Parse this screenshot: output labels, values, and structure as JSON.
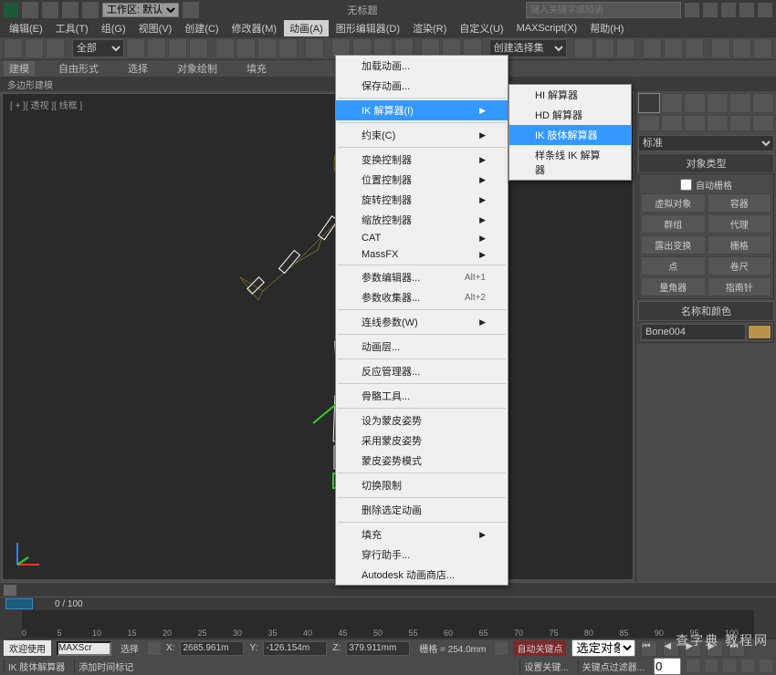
{
  "titlebar": {
    "workspace_label": "工作区: 默认",
    "doc_title": "无标题",
    "search_placeholder": "键入关键字或短语"
  },
  "menubar": {
    "items": [
      {
        "label": "编辑(E)"
      },
      {
        "label": "工具(T)"
      },
      {
        "label": "组(G)"
      },
      {
        "label": "视图(V)"
      },
      {
        "label": "创建(C)"
      },
      {
        "label": "修改器(M)"
      },
      {
        "label": "动画(A)"
      },
      {
        "label": "图形编辑器(D)"
      },
      {
        "label": "渲染(R)"
      },
      {
        "label": "自定义(U)"
      },
      {
        "label": "MAXScript(X)"
      },
      {
        "label": "帮助(H)"
      }
    ],
    "active_index": 6
  },
  "toolbar": {
    "selection_filter": "全部",
    "named_sel": "创建选择集"
  },
  "ribbon": {
    "tabs": [
      "建模",
      "自由形式",
      "选择",
      "对象绘制",
      "填充"
    ],
    "subtab": "多边形建模"
  },
  "viewport": {
    "label": "[ + ][ 透视 ][ 线框 ]"
  },
  "anim_menu": {
    "items": [
      {
        "label": "加载动画...",
        "type": "item"
      },
      {
        "label": "保存动画...",
        "type": "item"
      },
      {
        "type": "sep"
      },
      {
        "label": "IK 解算器(I)",
        "type": "submenu",
        "highlighted": true
      },
      {
        "type": "sep"
      },
      {
        "label": "约束(C)",
        "type": "submenu"
      },
      {
        "type": "sep"
      },
      {
        "label": "变换控制器",
        "type": "submenu"
      },
      {
        "label": "位置控制器",
        "type": "submenu"
      },
      {
        "label": "旋转控制器",
        "type": "submenu"
      },
      {
        "label": "缩放控制器",
        "type": "submenu"
      },
      {
        "label": "CAT",
        "type": "submenu"
      },
      {
        "label": "MassFX",
        "type": "submenu"
      },
      {
        "type": "sep"
      },
      {
        "label": "参数编辑器...",
        "type": "item",
        "shortcut": "Alt+1"
      },
      {
        "label": "参数收集器...",
        "type": "item",
        "shortcut": "Alt+2"
      },
      {
        "type": "sep"
      },
      {
        "label": "连线参数(W)",
        "type": "submenu"
      },
      {
        "type": "sep"
      },
      {
        "label": "动画层...",
        "type": "item"
      },
      {
        "type": "sep"
      },
      {
        "label": "反应管理器...",
        "type": "item"
      },
      {
        "type": "sep"
      },
      {
        "label": "骨骼工具...",
        "type": "item"
      },
      {
        "type": "sep"
      },
      {
        "label": "设为蒙皮姿势",
        "type": "item"
      },
      {
        "label": "采用蒙皮姿势",
        "type": "item"
      },
      {
        "label": "蒙皮姿势模式",
        "type": "item"
      },
      {
        "type": "sep"
      },
      {
        "label": "切换限制",
        "type": "item"
      },
      {
        "type": "sep"
      },
      {
        "label": "删除选定动画",
        "type": "item"
      },
      {
        "type": "sep"
      },
      {
        "label": "填充",
        "type": "submenu"
      },
      {
        "label": "穿行助手...",
        "type": "item"
      },
      {
        "label": "Autodesk 动画商店...",
        "type": "item"
      }
    ]
  },
  "ik_submenu": {
    "items": [
      {
        "label": "HI 解算器"
      },
      {
        "label": "HD 解算器"
      },
      {
        "label": "IK 肢体解算器",
        "highlighted": true
      },
      {
        "label": "样条线 IK 解算器"
      }
    ]
  },
  "command_panel": {
    "category": "标准",
    "rollout_object_type": "对象类型",
    "autogrid_label": "自动栅格",
    "buttons": [
      [
        "虚拟对象",
        "容器"
      ],
      [
        "群组",
        "代理"
      ],
      [
        "露出变换",
        "栅格"
      ],
      [
        "点",
        "卷尺"
      ],
      [
        "量角器",
        "指南针"
      ]
    ],
    "rollout_name_color": "名称和颜色",
    "object_name": "Bone004"
  },
  "timeline": {
    "current_frame": "0 / 100",
    "ticks": [
      "0",
      "5",
      "10",
      "15",
      "20",
      "25",
      "30",
      "35",
      "40",
      "45",
      "50",
      "55",
      "60",
      "65",
      "70",
      "75",
      "80",
      "85",
      "90",
      "95",
      "100"
    ]
  },
  "status": {
    "welcome": "欢迎使用",
    "maxscript_label": "MAXScr",
    "select_label": "选择",
    "x_label": "X:",
    "x_val": "2685.961m",
    "y_label": "Y:",
    "y_val": "-126.154m",
    "z_label": "Z:",
    "z_val": "379.911mm",
    "grid_label": "栅格 = 254.0mm",
    "autokey_label": "自动关键点",
    "sel_combo": "选定对象",
    "prompt": "IK 肢体解算器",
    "addtime": "添加时间标记",
    "setkey": "设置关键...",
    "keyfilter": "关键点过滤器..."
  },
  "watermark": "查字典 教程网"
}
